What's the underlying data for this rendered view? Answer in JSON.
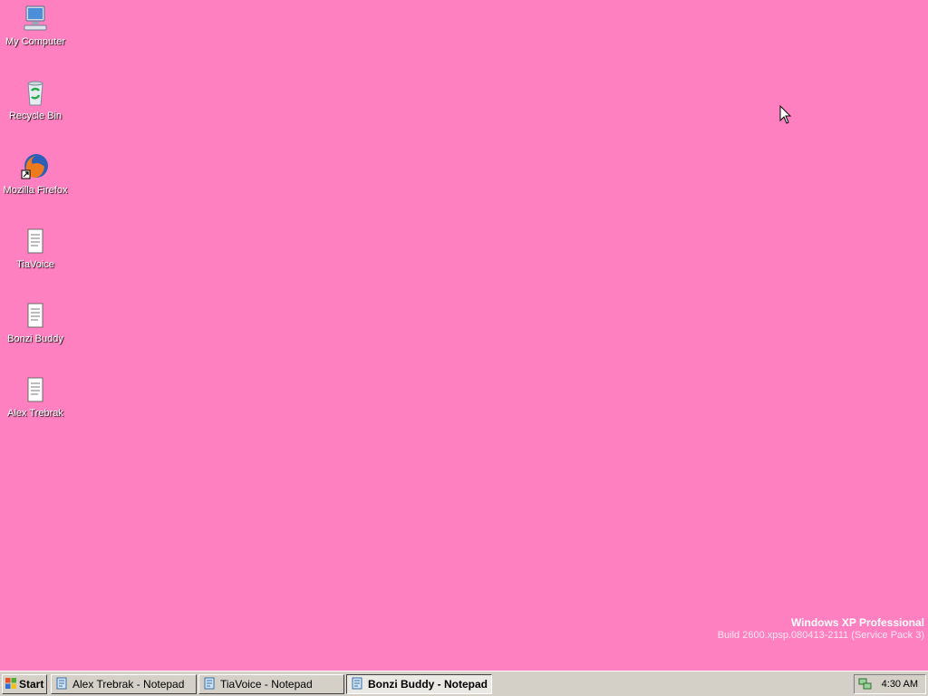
{
  "desktop": {
    "background": "#ff80c0",
    "icons": [
      {
        "label": "My Computer",
        "icon": "computer-icon"
      },
      {
        "label": "Recycle Bin",
        "icon": "recycle-bin-icon"
      },
      {
        "label": "Mozilla Firefox",
        "icon": "firefox-icon"
      },
      {
        "label": "TiaVoice",
        "icon": "text-document-icon"
      },
      {
        "label": "Bonzi Buddy",
        "icon": "text-document-icon"
      },
      {
        "label": "Alex Trebrak",
        "icon": "text-document-icon"
      }
    ],
    "watermark": {
      "title": "Windows XP Professional",
      "build": "Build 2600.xpsp.080413-2111 (Service Pack 3)"
    }
  },
  "taskbar": {
    "start_label": "Start",
    "tasks": [
      {
        "label": "Alex Trebrak - Notepad",
        "active": false,
        "icon": "notepad-icon"
      },
      {
        "label": "TiaVoice - Notepad",
        "active": false,
        "icon": "notepad-icon"
      },
      {
        "label": "Bonzi Buddy - Notepad",
        "active": true,
        "icon": "notepad-icon"
      }
    ],
    "tray": {
      "clock": "4:30 AM",
      "icons": [
        "network-icon"
      ]
    }
  }
}
